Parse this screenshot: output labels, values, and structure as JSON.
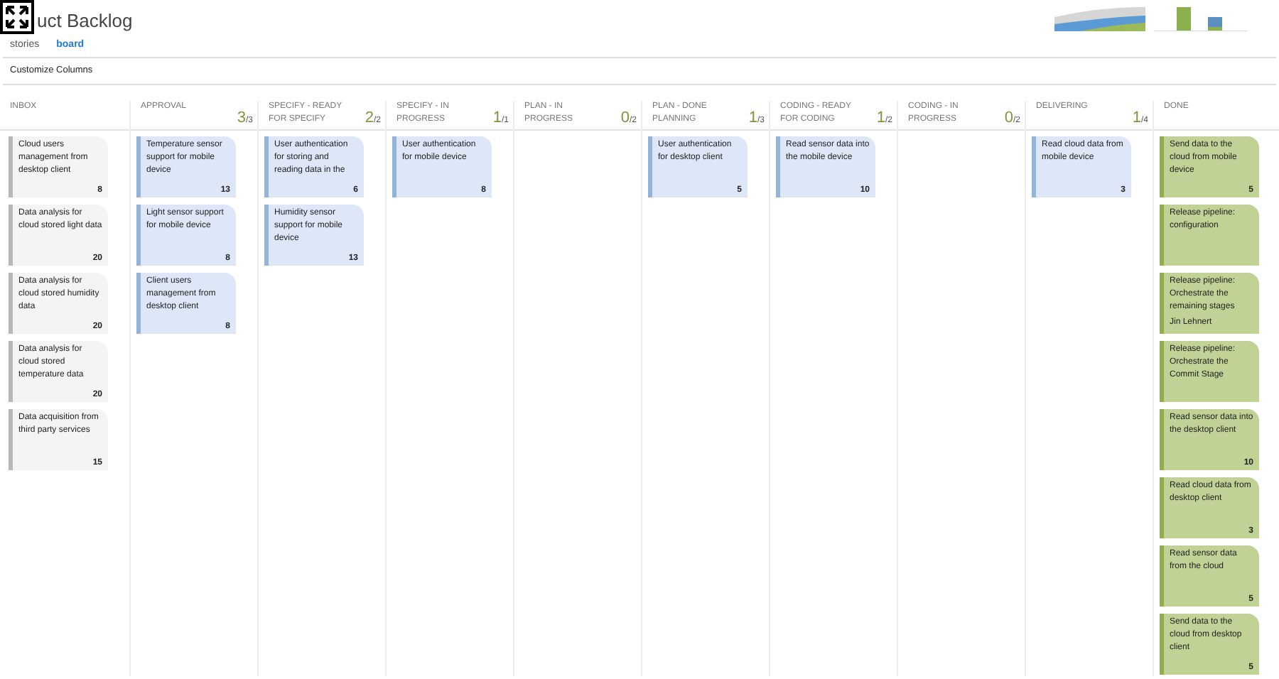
{
  "header": {
    "title": "uct Backlog",
    "tabs": [
      {
        "label": "stories",
        "selected": false
      },
      {
        "label": "board",
        "selected": true
      }
    ]
  },
  "toolbar": {
    "customize": "Customize Columns"
  },
  "columns": [
    {
      "name": "INBOX",
      "cards": [
        {
          "kind": "new",
          "title": "Cloud users management from desktop client",
          "points": "8"
        },
        {
          "kind": "new",
          "title": "Data analysis for cloud stored light data",
          "points": "20"
        },
        {
          "kind": "new",
          "title": "Data analysis for cloud stored humidity data",
          "points": "20"
        },
        {
          "kind": "new",
          "title": "Data analysis for cloud stored temperature data",
          "points": "20"
        },
        {
          "kind": "new",
          "title": "Data acquisition from third party services",
          "points": "15"
        }
      ]
    },
    {
      "name": "APPROVAL",
      "count": "3",
      "limit": "/3",
      "cards": [
        {
          "kind": "active",
          "title": "Temperature sensor support for mobile device",
          "points": "13"
        },
        {
          "kind": "active",
          "title": "Light sensor support for mobile device",
          "points": "8"
        },
        {
          "kind": "active",
          "title": "Client users management from desktop client",
          "points": "8"
        }
      ]
    },
    {
      "name": "SPECIFY - READY FOR SPECIFY",
      "count": "2",
      "limit": "/2",
      "cards": [
        {
          "kind": "active",
          "title": "User authentication for storing and reading data in the",
          "points": "6"
        },
        {
          "kind": "active",
          "title": "Humidity sensor support for mobile device",
          "points": "13"
        }
      ]
    },
    {
      "name": "SPECIFY - IN PROGRESS",
      "count": "1",
      "limit": "/1",
      "cards": [
        {
          "kind": "active",
          "title": "User authentication for mobile device",
          "points": "8"
        }
      ]
    },
    {
      "name": "PLAN - IN PROGRESS",
      "count": "0",
      "limit": "/2"
    },
    {
      "name": "PLAN - DONE PLANNING",
      "count": "1",
      "limit": "/3",
      "cards": [
        {
          "kind": "active",
          "title": "User authentication for desktop client",
          "points": "5"
        }
      ]
    },
    {
      "name": "CODING - READY FOR CODING",
      "count": "1",
      "limit": "/2",
      "cards": [
        {
          "kind": "active",
          "title": "Read sensor data into the mobile device",
          "points": "10"
        }
      ]
    },
    {
      "name": "CODING - IN PROGRESS",
      "count": "0",
      "limit": "/2"
    },
    {
      "name": "DELIVERING",
      "count": "1",
      "limit": "/4",
      "cards": [
        {
          "kind": "active",
          "title": "Read cloud data from mobile device",
          "points": "3"
        }
      ]
    },
    {
      "name": "DONE",
      "cards": [
        {
          "kind": "done",
          "title": "Send data to the cloud from mobile device",
          "points": "5"
        },
        {
          "kind": "done",
          "title": "Release pipeline: configuration"
        },
        {
          "kind": "done",
          "title": "Release pipeline: Orchestrate the remaining stages",
          "assignee": "Jin Lehnert"
        },
        {
          "kind": "done",
          "title": "Release pipeline: Orchestrate the Commit Stage"
        },
        {
          "kind": "done",
          "title": "Read sensor data into the desktop client",
          "points": "10"
        },
        {
          "kind": "done",
          "title": "Read cloud data from desktop client",
          "points": "3"
        },
        {
          "kind": "done",
          "title": "Read sensor data from the cloud",
          "points": "5"
        },
        {
          "kind": "done",
          "title": "Send data to the cloud from desktop client",
          "points": "5"
        }
      ]
    }
  ]
}
